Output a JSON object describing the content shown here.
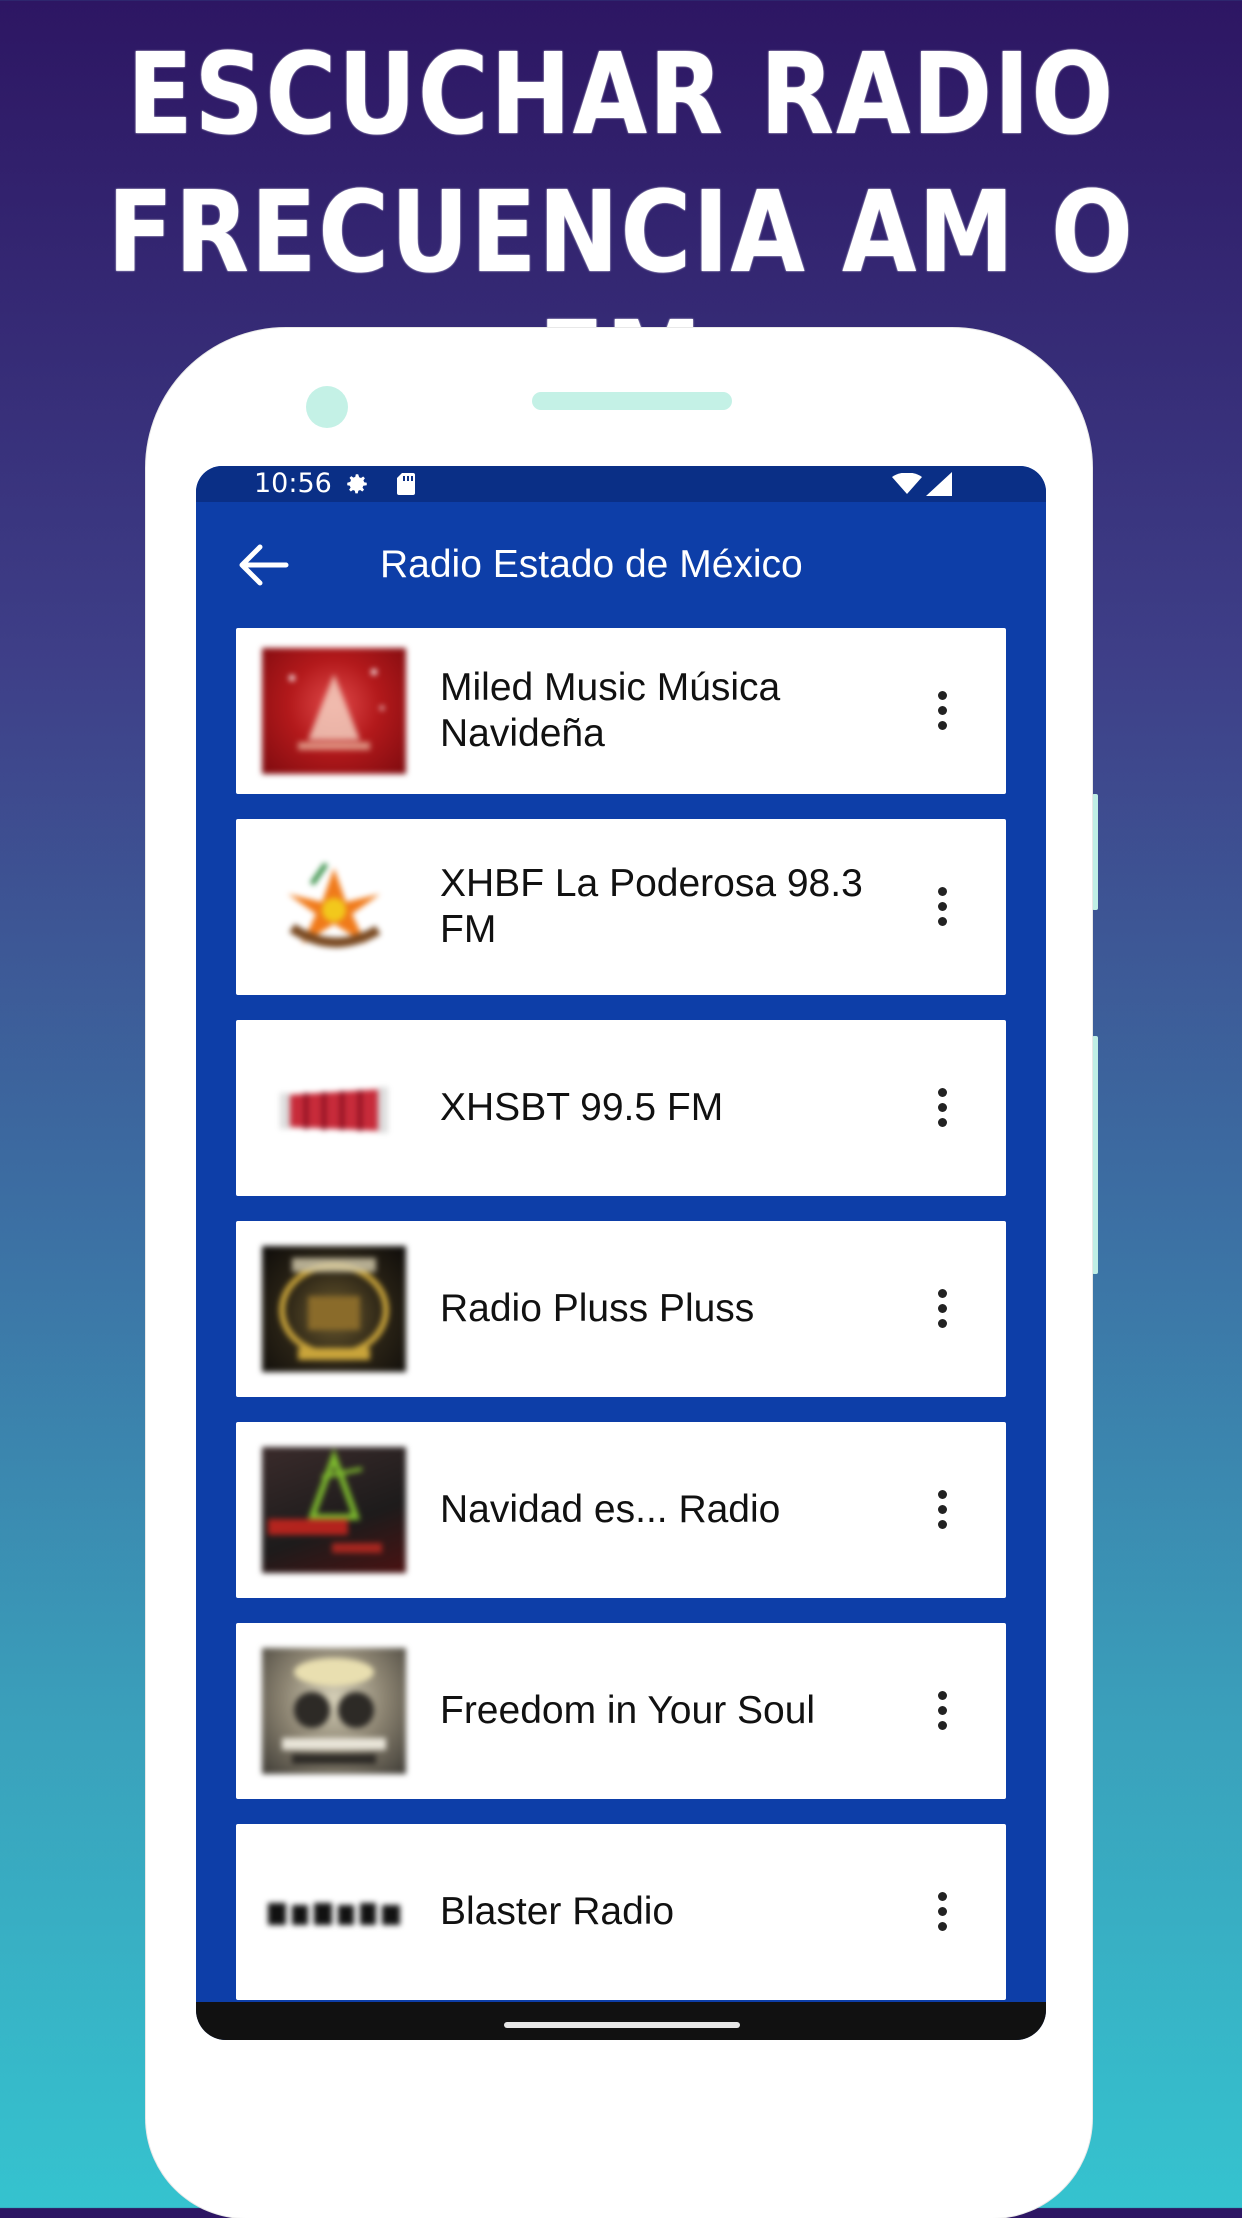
{
  "promo": {
    "title_line1": "ESCUCHAR RADIO",
    "title_line2": "FRECUENCIA AM O FM"
  },
  "status_bar": {
    "time": "10:56",
    "icons": [
      "gear-icon",
      "sd-card-icon",
      "wifi-icon",
      "signal-icon"
    ]
  },
  "app_bar": {
    "back_icon": "arrow-left-icon",
    "title": "Radio Estado de México"
  },
  "colors": {
    "app_blue": "#0d3ea8",
    "status_blue": "#0a2f86",
    "card_bg": "#ffffff"
  },
  "stations": [
    {
      "name": "Miled Music Música Navideña",
      "logo": "red-christmas-logo"
    },
    {
      "name": "XHBF La Poderosa 98.3 FM",
      "logo": "flower-logo"
    },
    {
      "name": "XHSBT 99.5 FM",
      "logo": "accordion-logo"
    },
    {
      "name": "Radio Pluss Pluss",
      "logo": "dark-emblem-logo"
    },
    {
      "name": "Navidad es... Radio",
      "logo": "christmas-tree-logo"
    },
    {
      "name": "Freedom in Your Soul",
      "logo": "soul-logo"
    },
    {
      "name": "Blaster Radio",
      "logo": "blaster-text-logo"
    }
  ]
}
